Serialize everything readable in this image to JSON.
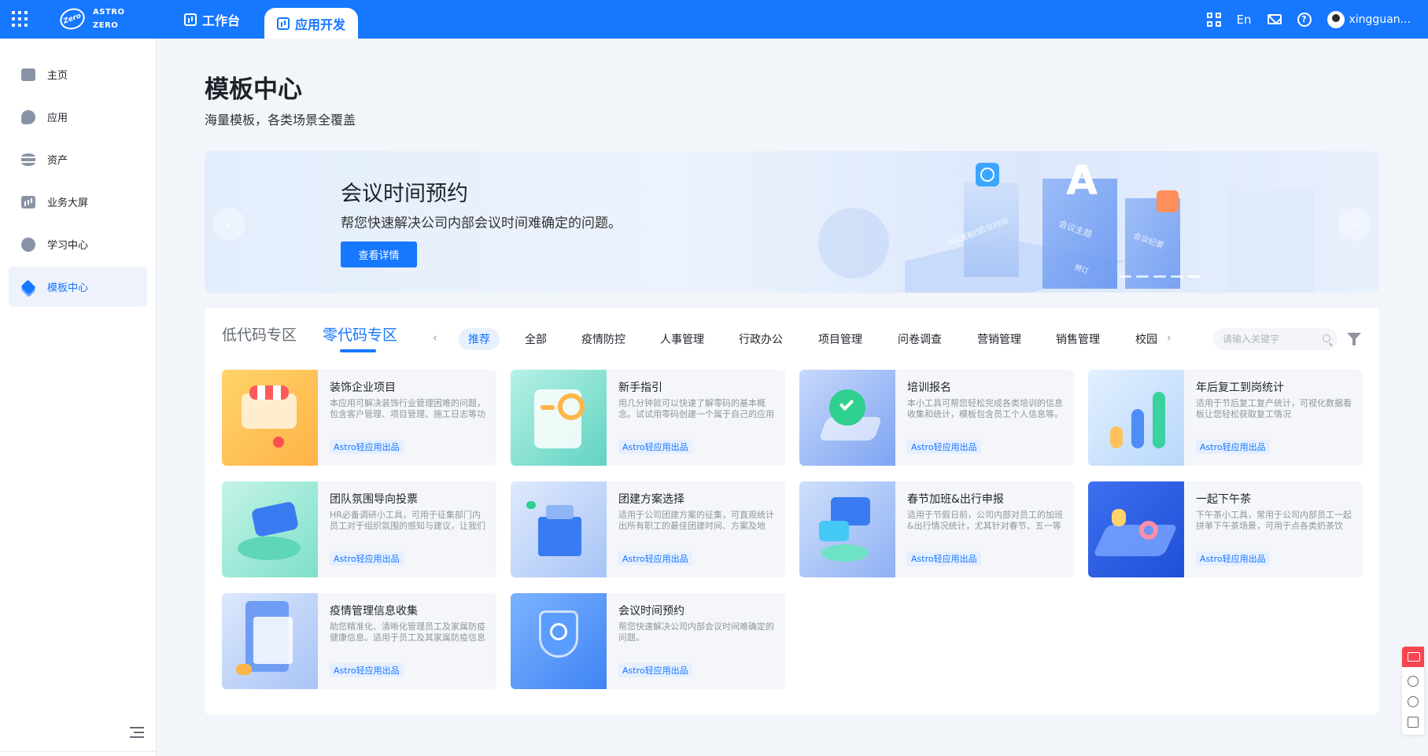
{
  "topbar": {
    "logo_line1": "ASTRO",
    "logo_line2": "ZERO",
    "logo_badge": "Zero",
    "tabs": [
      {
        "label": "工作台"
      },
      {
        "label": "应用开发"
      }
    ],
    "lang": "En",
    "help": "?",
    "username": "xingguan..."
  },
  "sidebar": {
    "items": [
      {
        "label": "主页"
      },
      {
        "label": "应用"
      },
      {
        "label": "资产"
      },
      {
        "label": "业务大屏"
      },
      {
        "label": "学习中心"
      },
      {
        "label": "模板中心"
      }
    ]
  },
  "page": {
    "title": "模板中心",
    "subtitle": "海量模板，各类场景全覆盖"
  },
  "banner": {
    "title": "会议时间预约",
    "desc": "帮您快速解决公司内部会议时间难确定的问题。",
    "button": "查看详情",
    "prev": "‹",
    "next": "›",
    "art_labels": [
      "会议时间",
      "会议主题",
      "会议纪要",
      "会议室租约",
      "预订"
    ],
    "art_letter": "A"
  },
  "zones": {
    "low_code": "低代码专区",
    "zero_code": "零代码专区"
  },
  "categories": {
    "prev": "‹",
    "next": "›",
    "items": [
      "推荐",
      "全部",
      "疫情防控",
      "人事管理",
      "行政办公",
      "项目管理",
      "问卷调查",
      "营销管理",
      "销售管理",
      "校园"
    ]
  },
  "search": {
    "placeholder": "请输入关键字"
  },
  "templates": [
    {
      "title": "装饰企业项目",
      "desc": "本应用可解决装饰行业管理困难的问题，包含客户管理、项目管理、施工日志等功能。",
      "tag": "Astro轻应用出品"
    },
    {
      "title": "新手指引",
      "desc": "用几分钟就可以快速了解零码的基本概念。试试用零码创建一个属于自己的应用吧。",
      "tag": "Astro轻应用出品"
    },
    {
      "title": "培训报名",
      "desc": "本小工具可帮您轻松完成各类培训的信息收集和统计，模板包含员工个人信息等。",
      "tag": "Astro轻应用出品"
    },
    {
      "title": "年后复工到岗统计",
      "desc": "适用于节后复工复产统计，可视化数据看板让您轻松获取复工情况",
      "tag": "Astro轻应用出品"
    },
    {
      "title": "团队氛围导向投票",
      "desc": "HR必备调研小工具，可用于征集部门内员工对于组织氛围的感知与建议，让我们一起打造更好的团队。",
      "tag": "Astro轻应用出品"
    },
    {
      "title": "团建方案选择",
      "desc": "适用于公司团建方案的征集，可直观统计出所有职工的最佳团建时间、方案及地点。",
      "tag": "Astro轻应用出品"
    },
    {
      "title": "春节加班&出行申报",
      "desc": "适用于节假日前，公司内部对员工的加班&出行情况统计，尤其针对春节、五一等长假。",
      "tag": "Astro轻应用出品"
    },
    {
      "title": "一起下午茶",
      "desc": "下午茶小工具，常用于公司内部员工一起拼单下午茶场景，可用于点各类奶茶饮品。",
      "tag": "Astro轻应用出品"
    },
    {
      "title": "疫情管理信息收集",
      "desc": "助您精准化、清晰化管理员工及家属防疫健康信息。适用于员工及其家属防疫信息收集。",
      "tag": "Astro轻应用出品"
    },
    {
      "title": "会议时间预约",
      "desc": "帮您快速解决公司内部会议时间难确定的问题。",
      "tag": "Astro轻应用出品"
    }
  ],
  "colors": {
    "brand": "#1677ff",
    "tag_bg": "#e6efff",
    "card_bg": "#f4f6f9"
  }
}
